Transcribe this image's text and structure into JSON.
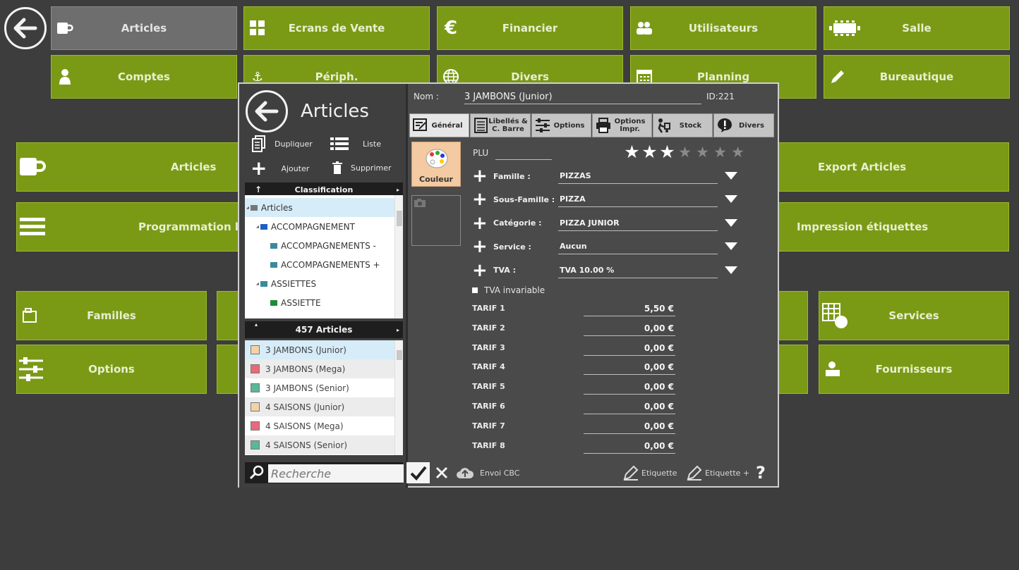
{
  "top_nav": {
    "back_icon": "arrow-left-icon",
    "tiles": [
      {
        "label": "Articles",
        "icon": "mug-icon",
        "selected": true
      },
      {
        "label": "Ecrans de Vente",
        "icon": "grid-icon"
      },
      {
        "label": "Financier",
        "icon": "euro-icon"
      },
      {
        "label": "Utilisateurs",
        "icon": "users-icon"
      },
      {
        "label": "Salle",
        "icon": "table-icon"
      },
      {
        "label": "Comptes",
        "icon": "person-icon"
      },
      {
        "label": "Périph.",
        "icon": "usb-icon"
      },
      {
        "label": "Divers",
        "icon": "globe-icon"
      },
      {
        "label": "Planning",
        "icon": "calendar-icon"
      },
      {
        "label": "Bureautique",
        "icon": "pencil-icon"
      }
    ]
  },
  "bg_tiles": {
    "articles": "Articles",
    "programmation": "Programmation lo",
    "export": "Export Articles",
    "impression": "Impression étiquettes",
    "familles": "Familles",
    "options": "Options",
    "services": "Services",
    "fournisseurs": "Fournisseurs"
  },
  "dialog": {
    "title": "Articles",
    "actions": {
      "duplicate": "Dupliquer",
      "list": "Liste",
      "add": "Ajouter",
      "delete": "Supprimer"
    },
    "classification": {
      "header": "Classification",
      "items": [
        {
          "label": "Articles",
          "level": 0,
          "color": "#777777",
          "selected": true
        },
        {
          "label": "ACCOMPAGNEMENT",
          "level": 1,
          "color": "#1f5fc0"
        },
        {
          "label": "ACCOMPAGNEMENTS -",
          "level": 2,
          "color": "#3a8a9a"
        },
        {
          "label": "ACCOMPAGNEMENTS +",
          "level": 2,
          "color": "#3a8a9a"
        },
        {
          "label": "ASSIETTES",
          "level": 1,
          "color": "#3a8a9a"
        },
        {
          "label": "ASSIETTE",
          "level": 2,
          "color": "#1e8a3a"
        }
      ]
    },
    "list": {
      "header": "457 Articles",
      "items": [
        {
          "label": "3 JAMBONS (Junior)",
          "color": "#f2d2a8",
          "selected": true
        },
        {
          "label": "3 JAMBONS (Mega)",
          "color": "#e86a7a"
        },
        {
          "label": "3 JAMBONS (Senior)",
          "color": "#5cb894"
        },
        {
          "label": "4 SAISONS (Junior)",
          "color": "#f2d2a8"
        },
        {
          "label": "4 SAISONS (Mega)",
          "color": "#e86a7a"
        },
        {
          "label": "4 SAISONS (Senior)",
          "color": "#5cb894"
        }
      ]
    },
    "search": {
      "placeholder": "Recherche"
    },
    "nom_label": "Nom :",
    "nom_value": "3 JAMBONS (Junior)",
    "id_text": "ID:221",
    "tabs": [
      {
        "label": "Général",
        "icon": "edit-icon",
        "selected": true
      },
      {
        "label": "Libellés & C. Barre",
        "icon": "barcode-doc-icon"
      },
      {
        "label": "Options",
        "icon": "sliders-icon"
      },
      {
        "label": "Options Impr.",
        "icon": "printer-icon"
      },
      {
        "label": "Stock",
        "icon": "dolly-icon"
      },
      {
        "label": "Divers",
        "icon": "alert-icon"
      }
    ],
    "couleur": {
      "label": "Couleur",
      "swatch": "#f3caa1",
      "icon": "palette-icon"
    },
    "plu_label": "PLU",
    "plu_value": "",
    "rating": {
      "value": 3,
      "max": 7
    },
    "fields": [
      {
        "label": "Famille :",
        "value": "PIZZAS"
      },
      {
        "label": "Sous-Famille :",
        "value": "PIZZA"
      },
      {
        "label": "Catégorie :",
        "value": "PIZZA JUNIOR"
      },
      {
        "label": "Service :",
        "value": "Aucun"
      },
      {
        "label": "TVA :",
        "value": "TVA 10.00 %"
      }
    ],
    "tva_invariable": "TVA invariable",
    "tarifs": [
      {
        "label": "TARIF 1",
        "value": "5,50 €"
      },
      {
        "label": "TARIF 2",
        "value": "0,00 €"
      },
      {
        "label": "TARIF 3",
        "value": "0,00 €"
      },
      {
        "label": "TARIF 4",
        "value": "0,00 €"
      },
      {
        "label": "TARIF 5",
        "value": "0,00 €"
      },
      {
        "label": "TARIF 6",
        "value": "0,00 €"
      },
      {
        "label": "TARIF 7",
        "value": "0,00 €"
      },
      {
        "label": "TARIF 8",
        "value": "0,00 €"
      }
    ],
    "bottom": {
      "envoi": "Envoi CBC",
      "etiquette": "Etiquette",
      "etiquette_plus": "Etiquette +",
      "help": "?"
    }
  },
  "colors": {
    "tile": "#7a9a16",
    "tile_selected": "#6e6e6e",
    "background": "#3d3d3d",
    "dialog": "#4a4a4a"
  }
}
